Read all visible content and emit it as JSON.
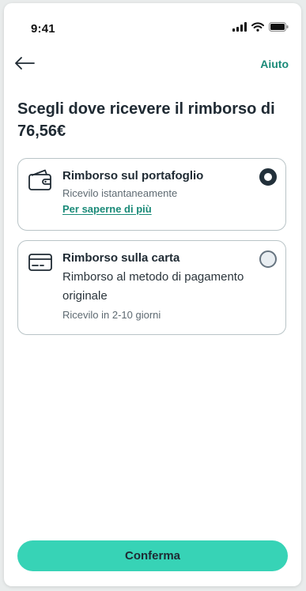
{
  "status_bar": {
    "time": "9:41"
  },
  "nav": {
    "help_label": "Aiuto"
  },
  "title": "Scegli dove ricevere il rimborso di 76,56€",
  "options": [
    {
      "title": "Rimborso sul portafoglio",
      "subtitle": "Ricevilo istantaneamente",
      "link": "Per saperne di più",
      "selected": true,
      "icon": "wallet-icon"
    },
    {
      "title": "Rimborso sulla carta",
      "description": "Rimborso al metodo di pagamento originale",
      "subtitle": "Ricevilo in 2-10 giorni",
      "selected": false,
      "icon": "credit-card-icon"
    }
  ],
  "confirm_label": "Conferma",
  "colors": {
    "accent": "#37d3b6",
    "link": "#1a8a78",
    "text": "#1f2a33",
    "border": "#b9c4c7"
  }
}
